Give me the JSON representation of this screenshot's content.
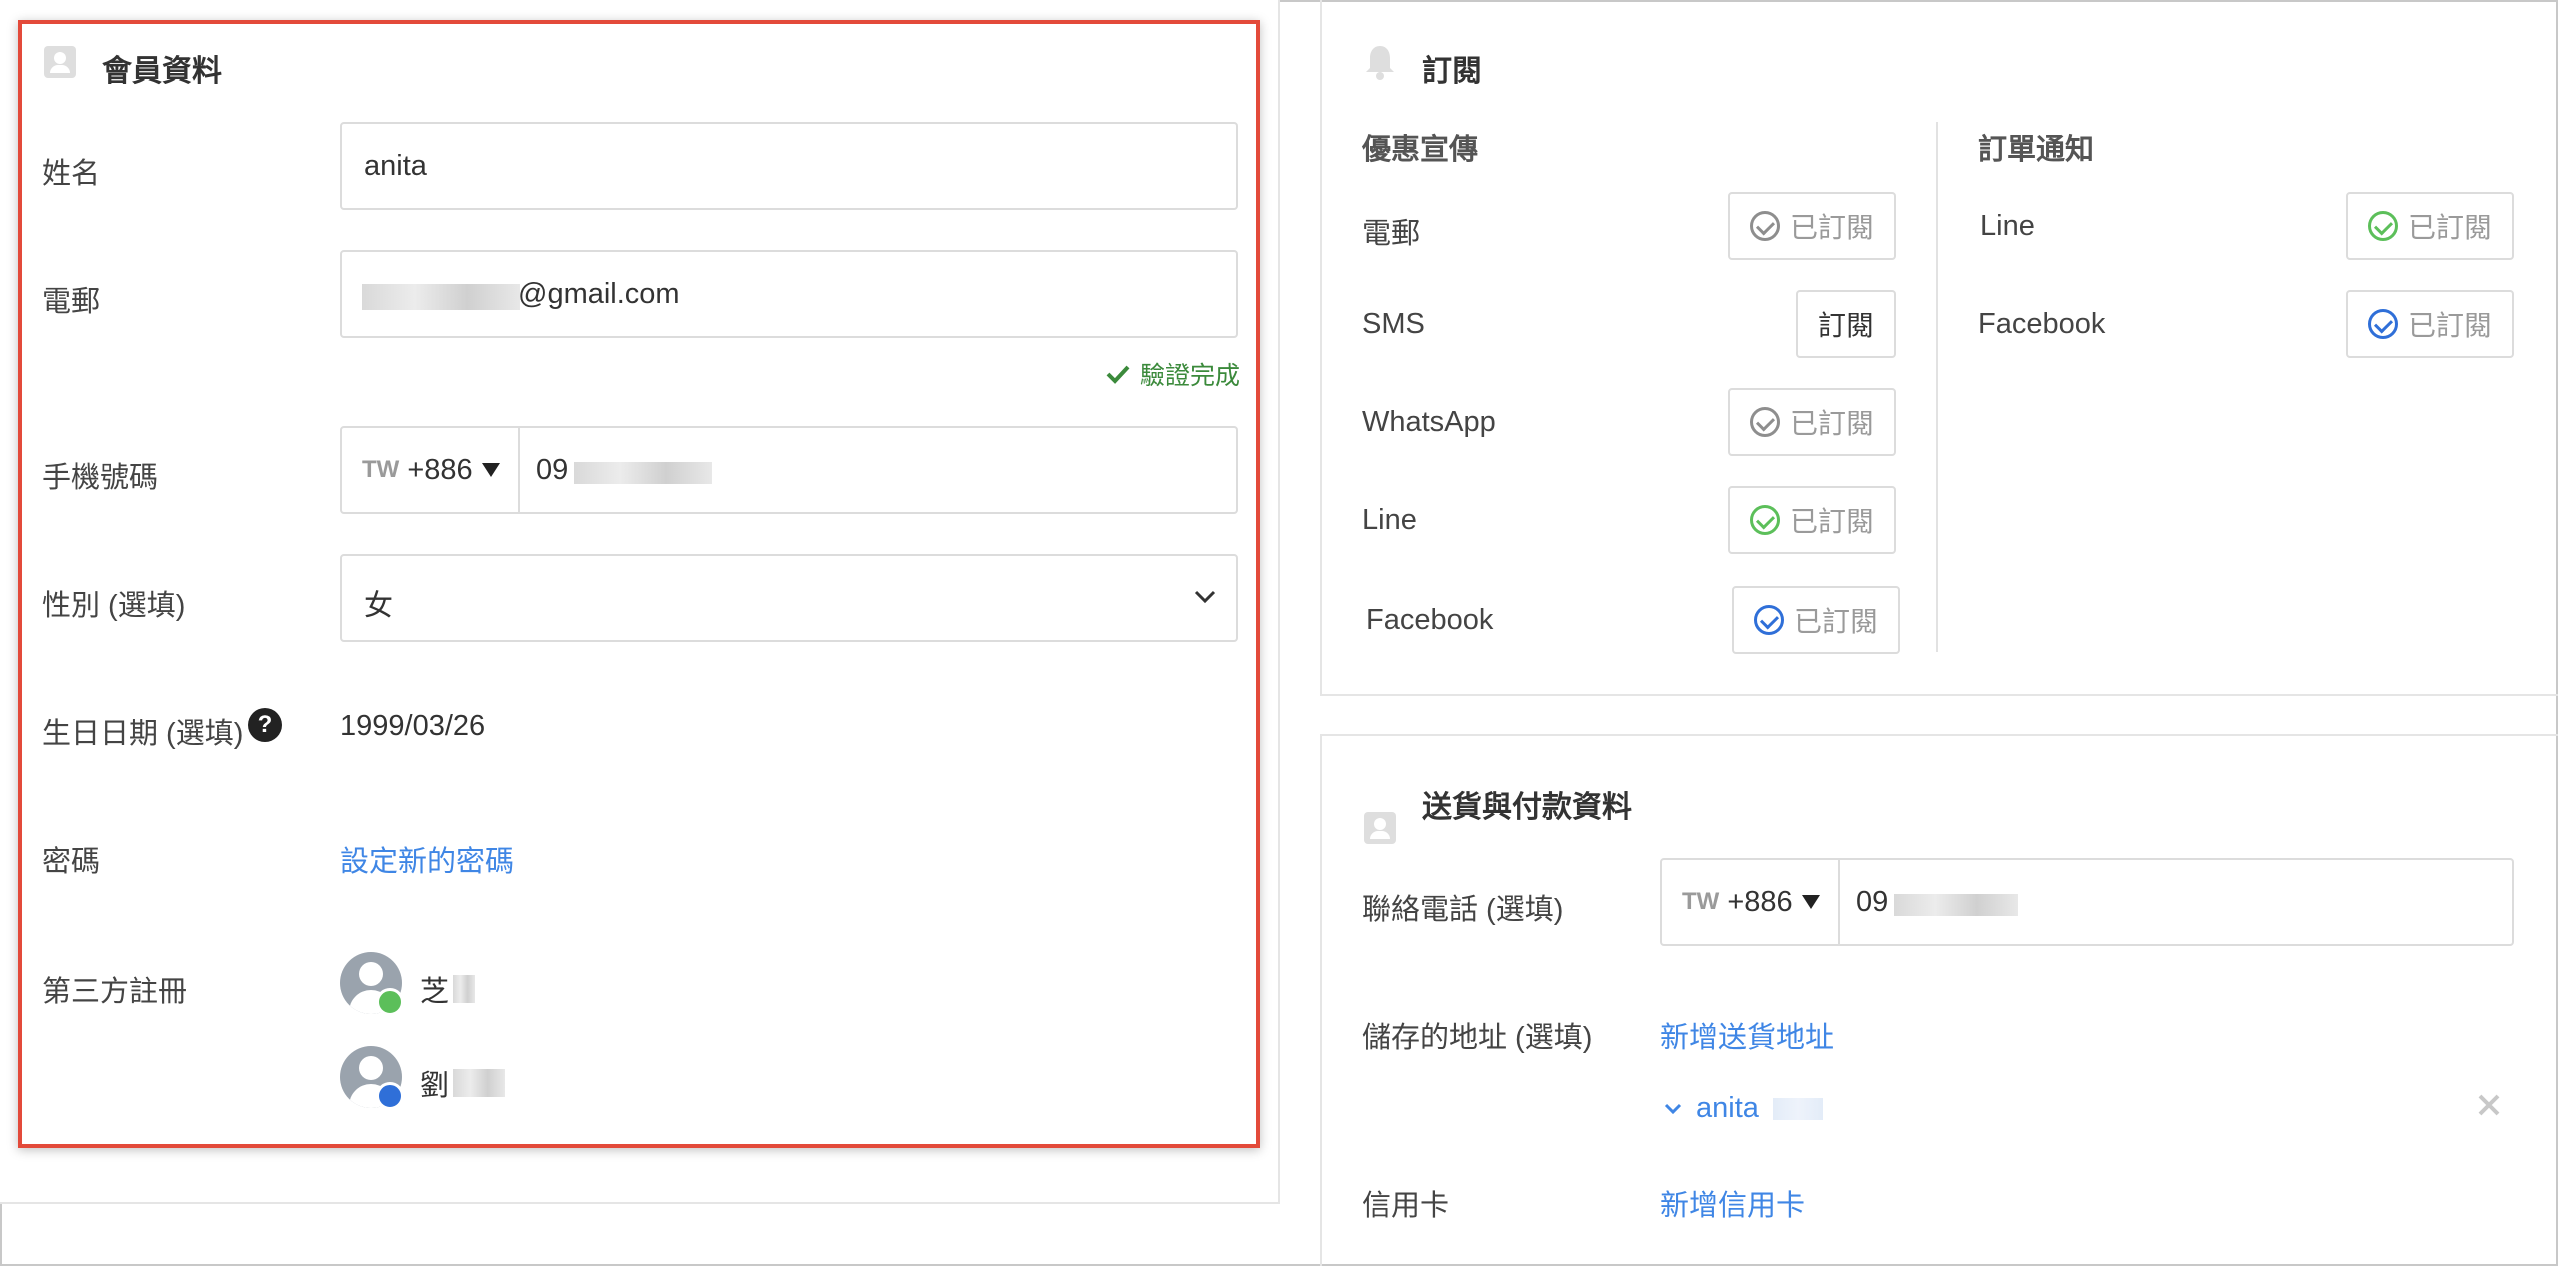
{
  "member": {
    "title": "會員資料",
    "name_label": "姓名",
    "name_value": "anita",
    "email_label": "電郵",
    "email_value": "@gmail.com",
    "verified_text": "驗證完成",
    "phone_label": "手機號碼",
    "phone_country": "TW",
    "phone_code": "+886",
    "phone_value": "09",
    "gender_label": "性別 (選填)",
    "gender_value": "女",
    "birthday_label": "生日日期 (選填)",
    "birthday_value": "1999/03/26",
    "password_label": "密碼",
    "password_link": "設定新的密碼",
    "third_party_label": "第三方註冊",
    "accounts": [
      {
        "name": "芝",
        "provider": "line"
      },
      {
        "name": "劉",
        "provider": "facebook"
      }
    ]
  },
  "subscription": {
    "title": "訂閱",
    "promo_header": "優惠宣傳",
    "order_header": "訂單通知",
    "subscribed_label": "已訂閱",
    "subscribe_label": "訂閱",
    "promo_channels": [
      "電郵",
      "SMS",
      "WhatsApp",
      "Line",
      "Facebook"
    ],
    "order_channels": [
      "Line",
      "Facebook"
    ]
  },
  "shipping": {
    "title": "送貨與付款資料",
    "contact_label": "聯絡電話 (選填)",
    "phone_country": "TW",
    "phone_code": "+886",
    "phone_value": "09",
    "address_label": "儲存的地址 (選填)",
    "add_address_link": "新增送貨地址",
    "saved_address_name": "anita",
    "card_label": "信用卡",
    "add_card_link": "新增信用卡"
  },
  "colors": {
    "accent_link": "#3f86e5",
    "highlight_border": "#e34a3a",
    "verified_green": "#3b8a3b",
    "line_green": "#5cbf5a",
    "facebook_blue": "#2f6fd8"
  }
}
